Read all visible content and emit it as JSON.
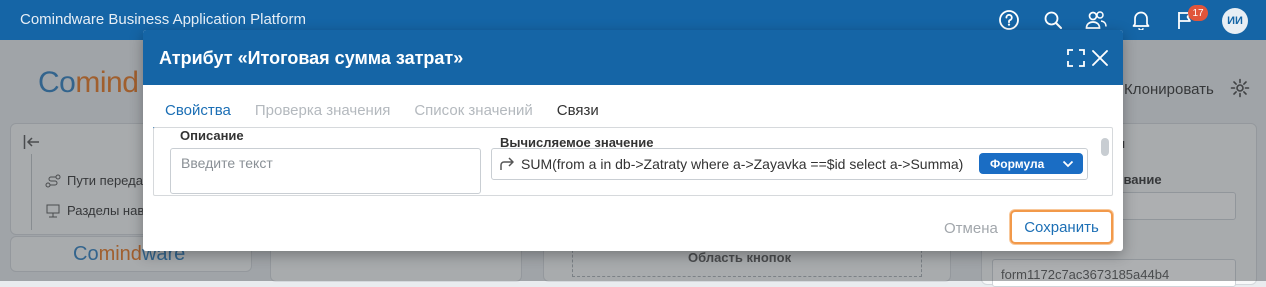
{
  "app": {
    "title": "Comindware Business Application Platform",
    "notifications_count": "17",
    "user_initials": "ИИ"
  },
  "background": {
    "logo_part1": "Co",
    "logo_part2": "mind",
    "sidebar_items": [
      "Пути переда",
      "Разделы нав"
    ],
    "logo_small_part1": "Co",
    "logo_small_part2": "mind",
    "logo_small_part3": "ware",
    "clone_label": "Клонировать",
    "right_panel_label_1": "ы",
    "right_panel_label_2": "звание",
    "bottom_center_label": "Область кнопок",
    "bottom_right_value": "form1172c7ac3673185a44b4"
  },
  "modal": {
    "title": "Атрибут «Итоговая сумма затрат»",
    "tabs": [
      {
        "label": "Свойства",
        "state": "active"
      },
      {
        "label": "Проверка значения",
        "state": "disabled"
      },
      {
        "label": "Список значений",
        "state": "disabled"
      },
      {
        "label": "Связи",
        "state": "normal"
      }
    ],
    "description": {
      "label": "Описание",
      "placeholder": "Введите текст"
    },
    "computed": {
      "label": "Вычисляемое значение",
      "expression": "SUM(from a in db->Zatraty where a->Zayavka ==$id select a->Summa)",
      "mode": "Формула"
    },
    "footer": {
      "cancel_label": "Отмена",
      "save_label": "Сохранить"
    }
  },
  "colors": {
    "primary": "#1565a6",
    "accent_button": "#1a6dc4",
    "highlight": "#f2994a",
    "badge": "#e0553b"
  },
  "icons": [
    "help-icon",
    "search-icon",
    "users-icon",
    "bell-icon",
    "flag-icon",
    "expand-icon",
    "close-icon",
    "formula-arrow-icon",
    "chevron-down-icon",
    "collapse-sidebar-icon",
    "gear-icon"
  ]
}
